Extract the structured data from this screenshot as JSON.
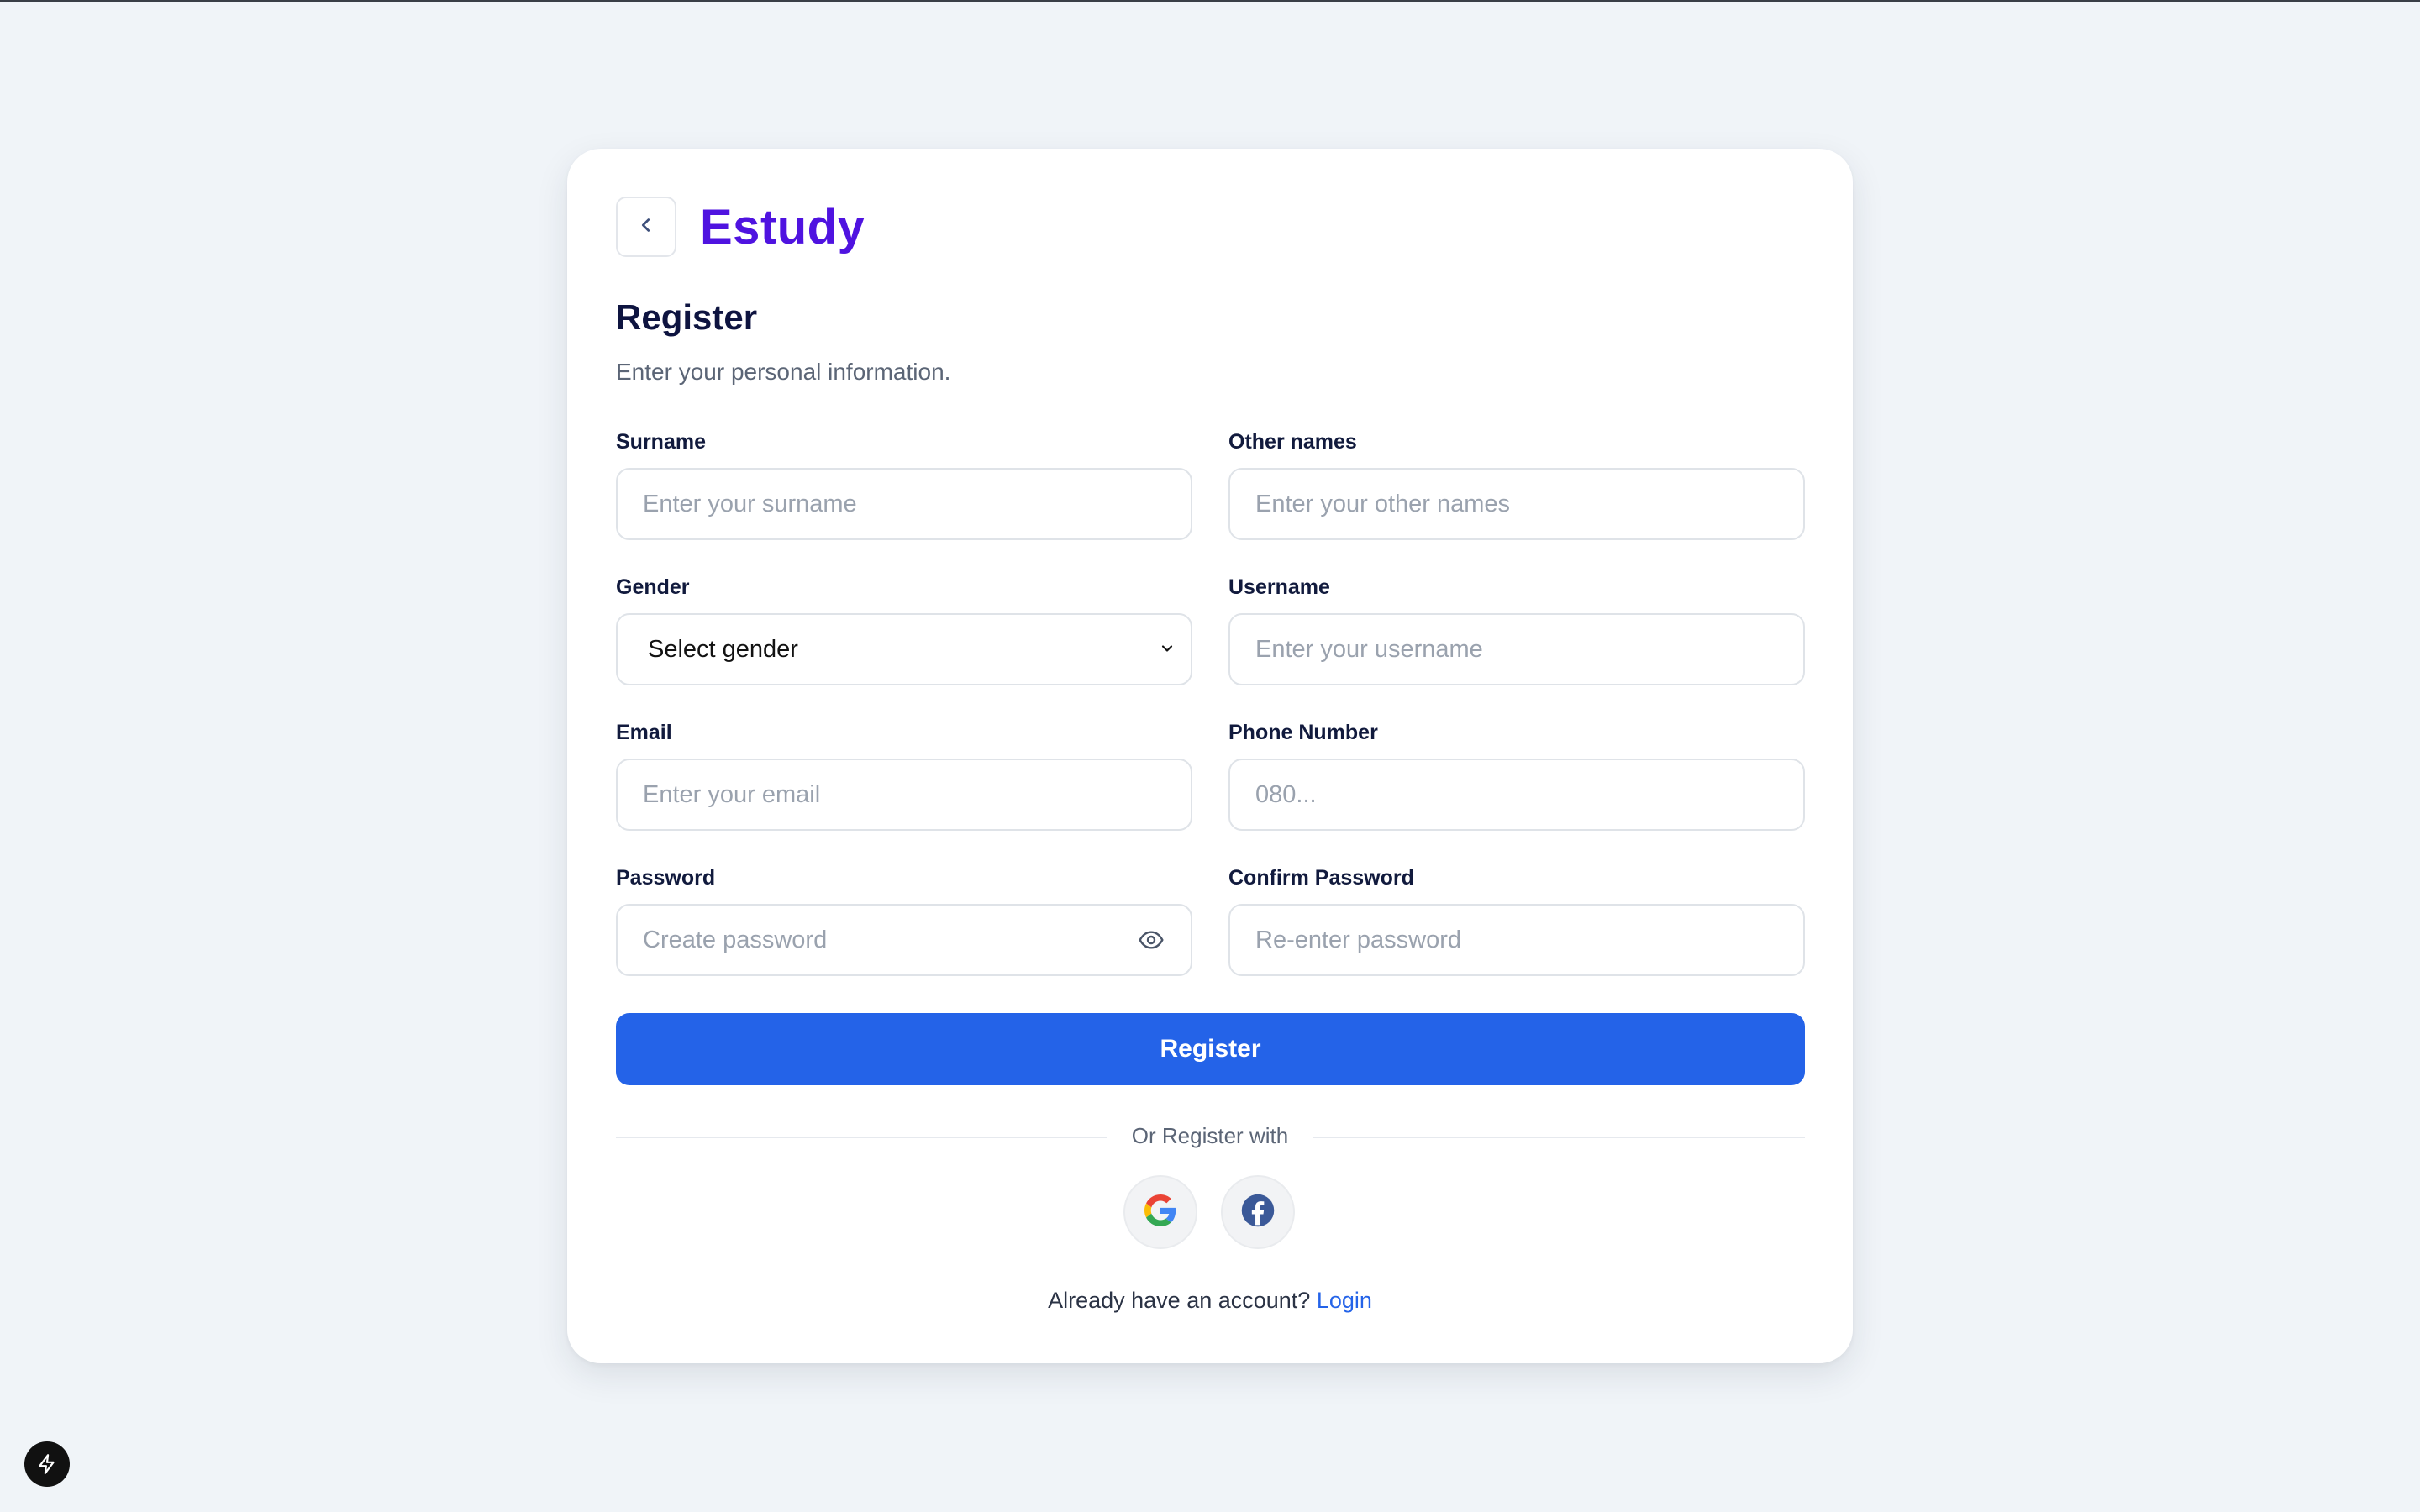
{
  "brand": {
    "name": "Estudy",
    "color": "#4f13e0"
  },
  "form": {
    "title": "Register",
    "subtitle": "Enter your personal information.",
    "fields": {
      "surname": {
        "label": "Surname",
        "placeholder": "Enter your surname"
      },
      "other_names": {
        "label": "Other names",
        "placeholder": "Enter your other names"
      },
      "gender": {
        "label": "Gender",
        "selected": "Select gender"
      },
      "username": {
        "label": "Username",
        "placeholder": "Enter your username"
      },
      "email": {
        "label": "Email",
        "placeholder": "Enter your email"
      },
      "phone": {
        "label": "Phone Number",
        "placeholder": "080..."
      },
      "password": {
        "label": "Password",
        "placeholder": "Create password",
        "toggle_icon": "eye-icon"
      },
      "confirm_password": {
        "label": "Confirm Password",
        "placeholder": "Re-enter password"
      }
    },
    "submit_label": "Register",
    "divider_text": "Or Register with",
    "social": [
      {
        "name": "google",
        "icon": "google-icon"
      },
      {
        "name": "facebook",
        "icon": "facebook-icon"
      }
    ],
    "login_prompt": "Already have an account?",
    "login_link": "Login"
  },
  "colors": {
    "primary": "#2463e8",
    "heading": "#0e1440",
    "background": "#f0f4f8"
  }
}
